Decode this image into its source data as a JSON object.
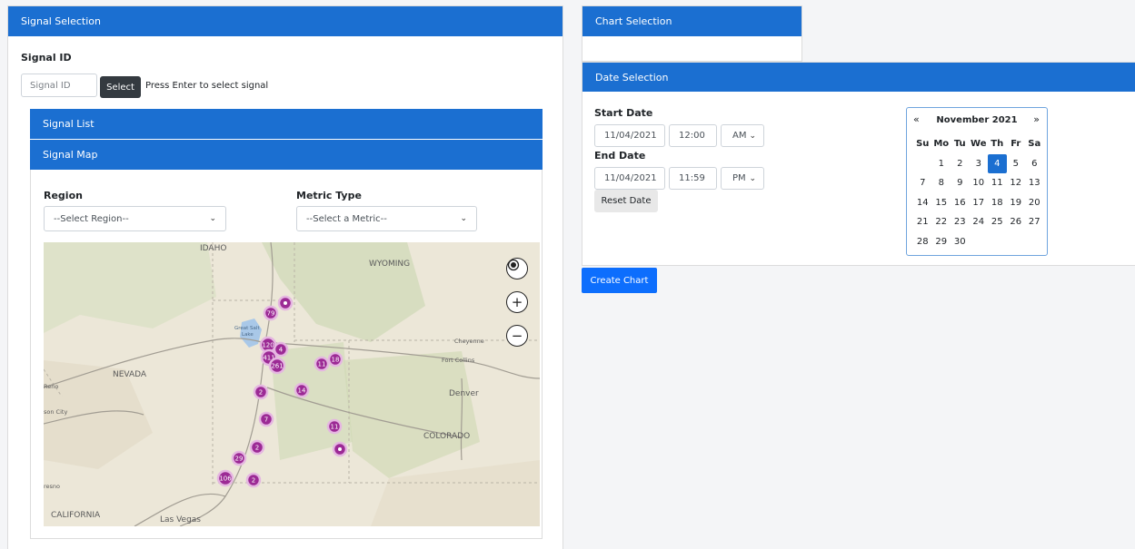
{
  "signal_selection": {
    "title": "Signal Selection",
    "signal_id_label": "Signal ID",
    "signal_id_placeholder": "Signal ID",
    "select_button": "Select",
    "hint": "Press Enter to select signal",
    "signal_list_title": "Signal List",
    "signal_map_title": "Signal Map",
    "region_label": "Region",
    "region_value": "--Select Region--",
    "metric_label": "Metric Type",
    "metric_value": "--Select a Metric--"
  },
  "map": {
    "places": [
      "IDAHO",
      "WYOMING",
      "NEVADA",
      "COLORADO",
      "CALIFORNIA",
      "Las Vegas",
      "Denver",
      "Cheyenne",
      "Fort Collins",
      "Great Salt Lake",
      "Reno",
      "son City",
      "resno"
    ],
    "clusters": [
      "79",
      "120",
      "4",
      "411",
      "261",
      "11",
      "18",
      "14",
      "2",
      "7",
      "11",
      "2",
      "29",
      "106",
      "2"
    ],
    "controls": [
      "locate-icon",
      "zoom-in-icon",
      "zoom-out-icon"
    ],
    "cluster_color": "#9c2a95"
  },
  "chart_selection": {
    "title": "Chart Selection"
  },
  "date_selection": {
    "title": "Date Selection",
    "start_label": "Start Date",
    "start_date": "11/04/2021",
    "start_time": "12:00",
    "start_ampm": "AM",
    "end_label": "End Date",
    "end_date": "11/04/2021",
    "end_time": "11:59",
    "end_ampm": "PM",
    "reset_button": "Reset Date"
  },
  "calendar": {
    "title": "November 2021",
    "prev": "«",
    "next": "»",
    "weekdays": [
      "Su",
      "Mo",
      "Tu",
      "We",
      "Th",
      "Fr",
      "Sa"
    ],
    "first_weekday": 1,
    "days": 30,
    "selected": 4
  },
  "create_chart_button": "Create Chart",
  "colors": {
    "header": "#1b6fd1",
    "primary_button": "#0d6efd",
    "dark_button": "#343a40"
  }
}
